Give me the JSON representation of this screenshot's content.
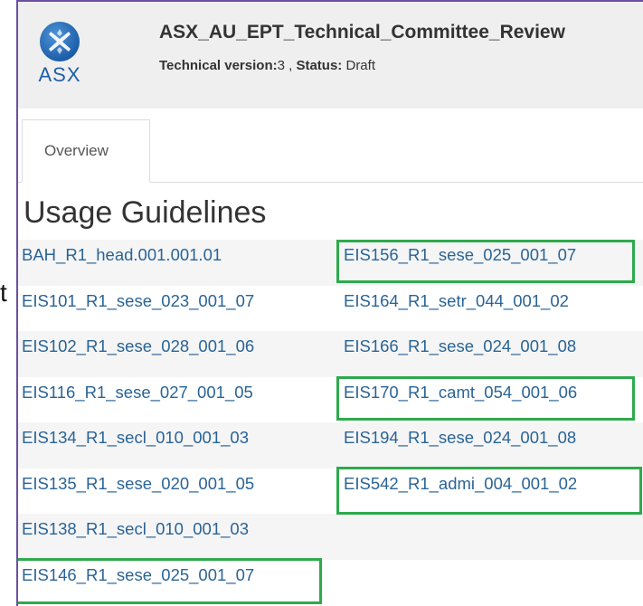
{
  "stray_char": "t",
  "header": {
    "logo_text": "ASX",
    "title": "ASX_AU_EPT_Technical_Committee_Review",
    "version_label": "Technical version:",
    "version_value": "3 ,",
    "status_label": "Status:",
    "status_value": "Draft"
  },
  "tabs": [
    {
      "label": "Overview",
      "active": true
    }
  ],
  "section_title": "Usage Guidelines",
  "guidelines": {
    "left": [
      "BAH_R1_head.001.001.01",
      "EIS101_R1_sese_023_001_07",
      "EIS102_R1_sese_028_001_06",
      "EIS116_R1_sese_027_001_05",
      "EIS134_R1_secl_010_001_03",
      "EIS135_R1_sese_020_001_05",
      "EIS138_R1_secl_010_001_03",
      "EIS146_R1_sese_025_001_07"
    ],
    "right": [
      "EIS156_R1_sese_025_001_07",
      "EIS164_R1_setr_044_001_02",
      "EIS166_R1_sese_024_001_08",
      "EIS170_R1_camt_054_001_06",
      "EIS194_R1_sese_024_001_08",
      "EIS542_R1_admi_004_001_02"
    ]
  },
  "colors": {
    "link": "#2a6496",
    "highlight_box": "#2eaa4c",
    "frame_border": "#6b4fa0",
    "header_bg": "#efefef",
    "stripe_bg": "#f5f5f5"
  }
}
